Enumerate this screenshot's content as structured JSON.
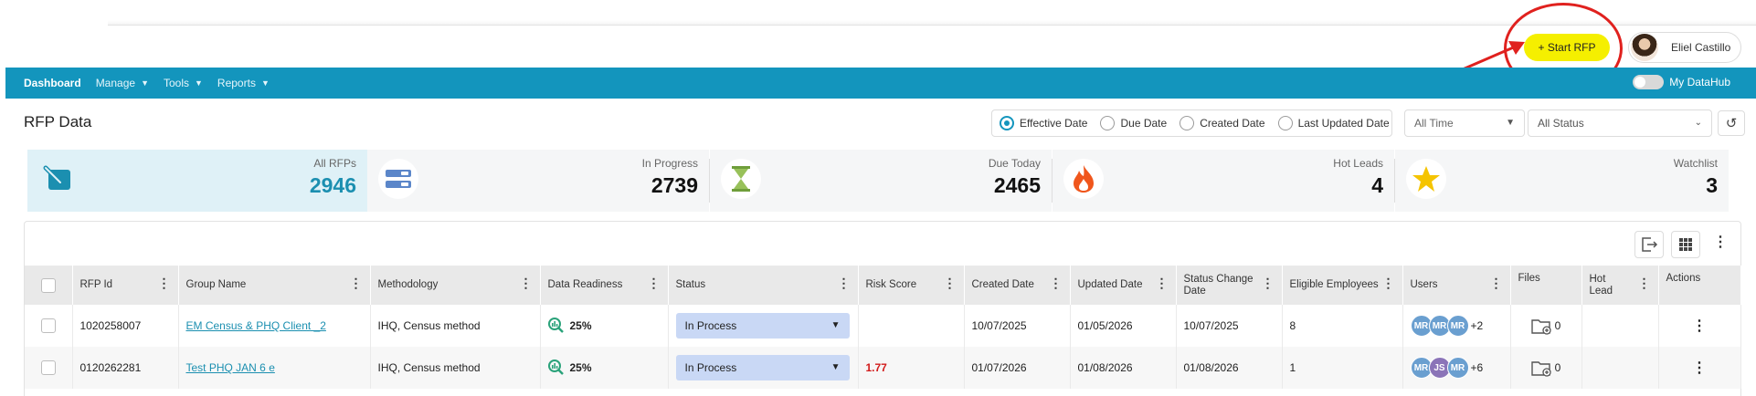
{
  "header": {
    "start_label": "+ Start RFP",
    "user_name": "Eliel Castillo"
  },
  "nav": {
    "dashboard": "Dashboard",
    "manage": "Manage",
    "tools": "Tools",
    "reports": "Reports",
    "hub_label": "My DataHub"
  },
  "page": {
    "title": "RFP Data"
  },
  "filters": {
    "options": [
      "Effective Date",
      "Due Date",
      "Created Date",
      "Last Updated Date"
    ],
    "selected": "Effective Date",
    "time_value": "All Time",
    "status_value": "All Status"
  },
  "stats": [
    {
      "label": "All RFPs",
      "value": "2946",
      "icon": "rfp-edit-icon"
    },
    {
      "label": "In Progress",
      "value": "2739",
      "icon": "progress-bars-icon"
    },
    {
      "label": "Due Today",
      "value": "2465",
      "icon": "hourglass-icon"
    },
    {
      "label": "Hot Leads",
      "value": "4",
      "icon": "flame-icon"
    },
    {
      "label": "Watchlist",
      "value": "3",
      "icon": "star-icon"
    }
  ],
  "table": {
    "columns": [
      "RFP Id",
      "Group Name",
      "Methodology",
      "Data Readiness",
      "Status",
      "Risk Score",
      "Created Date",
      "Updated Date",
      "Status Change Date",
      "Eligible Employees",
      "Users",
      "Files",
      "Hot Lead",
      "Actions"
    ],
    "rows": [
      {
        "id": "1020258007",
        "group": "EM Census & PHQ Client _2",
        "method": "IHQ, Census method",
        "readiness": "25%",
        "status": "In Process",
        "risk": "",
        "created": "10/07/2025",
        "updated": "01/05/2026",
        "changed": "10/07/2025",
        "eligible": "8",
        "users": [
          "MR",
          "MR",
          "MR"
        ],
        "users_more": "+2",
        "files": "0"
      },
      {
        "id": "0120262281",
        "group": "Test PHQ JAN 6 e",
        "method": "IHQ, Census method",
        "readiness": "25%",
        "status": "In Process",
        "risk": "1.77",
        "created": "01/07/2026",
        "updated": "01/08/2026",
        "changed": "01/08/2026",
        "eligible": "1",
        "users": [
          "MR",
          "JS",
          "MR"
        ],
        "users_more": "+6",
        "files": "0"
      }
    ]
  },
  "colors": {
    "accent": "#1395bd",
    "start_button": "#f5ef00",
    "annotation": "#e0211e",
    "risk": "#d21b1b",
    "status_bg": "#c9d8f5",
    "avatar_blue": "#6a9fd0",
    "avatar_purple": "#8b74b8"
  }
}
